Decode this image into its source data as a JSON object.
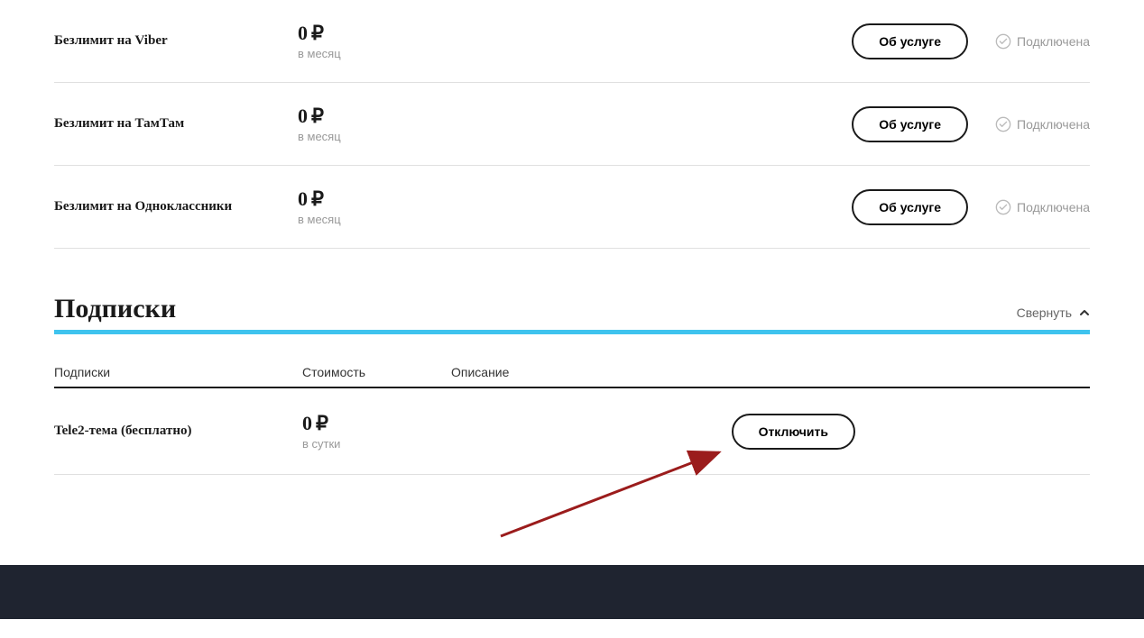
{
  "services": [
    {
      "name": "Безлимит на Viber",
      "price": "0",
      "currency": "₽",
      "period": "в месяц",
      "button": "Об услуге",
      "status": "Подключена"
    },
    {
      "name": "Безлимит на ТамТам",
      "price": "0",
      "currency": "₽",
      "period": "в месяц",
      "button": "Об услуге",
      "status": "Подключена"
    },
    {
      "name": "Безлимит на Одноклассники",
      "price": "0",
      "currency": "₽",
      "period": "в месяц",
      "button": "Об услуге",
      "status": "Подключена"
    }
  ],
  "subscriptions": {
    "title": "Подписки",
    "collapse": "Свернуть",
    "headers": {
      "name": "Подписки",
      "cost": "Стоимость",
      "desc": "Описание"
    },
    "items": [
      {
        "name": "Tele2-тема (бесплатно)",
        "price": "0",
        "currency": "₽",
        "period": "в сутки",
        "button": "Отключить"
      }
    ]
  }
}
